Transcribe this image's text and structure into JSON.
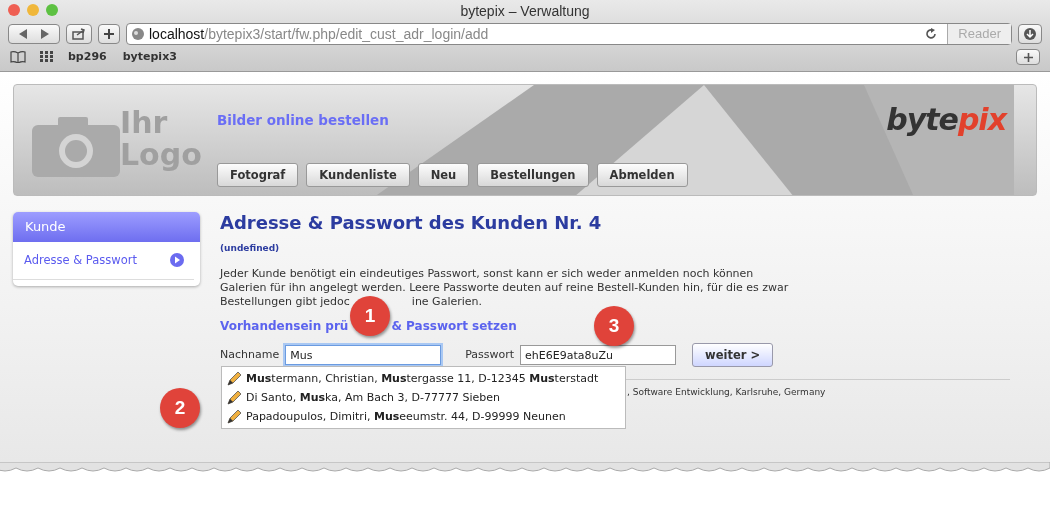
{
  "window": {
    "title": "bytepix – Verwaltung",
    "address_host": "localhost",
    "address_path": "/bytepix3/start/fw.php/edit_cust_adr_login/add",
    "reader": "Reader"
  },
  "bookmarks": [
    "bp296",
    "bytepix3"
  ],
  "header": {
    "logo_lines": [
      "Ihr",
      "Logo"
    ],
    "tagline": "Bilder online bestellen",
    "brand_left": "byte",
    "brand_right": "pix",
    "nav": [
      "Fotograf",
      "Kundenliste",
      "Neu",
      "Bestellungen",
      "Abmelden"
    ]
  },
  "sidebar": {
    "title": "Kunde",
    "items": [
      {
        "label": "Adresse & Passwort",
        "selected": true
      }
    ]
  },
  "main": {
    "title": "Adresse & Passwort des Kunden Nr. 4",
    "subtitle": "(undefined)",
    "paragraph_lines": [
      "Jeder Kunde benötigt ein eindeutiges Passwort, sonst kann er sich weder anmelden noch können",
      "Galerien für ihn angelegt werden. Leere Passworte deuten auf reine Bestell-Kunden hin, für die es zwar"
    ],
    "paragraph_last": [
      "Bestellungen gibt jedoc",
      "ine Galerien."
    ],
    "section_title": [
      "Vorhandensein prü",
      "& Passwort setzen"
    ],
    "form": {
      "name_label": "Nachname",
      "name_value": "Mus",
      "password_label": "Passwort",
      "password_value": "ehE6E9ata8uZu",
      "submit": "weiter >"
    },
    "suggestions": [
      "**Mus**termann, Christian, **Mus**tergasse 11, D-12345 **Mus**terstadt",
      "Di Santo, **Mus**ka, Am Bach 3, D-77777 Sieben",
      "Papadoupulos, Dimitri, **Mus**eeumstr. 44, D-99999 Neunen"
    ],
    "footer": ", Software Entwicklung, Karlsruhe, Germany"
  },
  "callouts": [
    "1",
    "2",
    "3"
  ]
}
